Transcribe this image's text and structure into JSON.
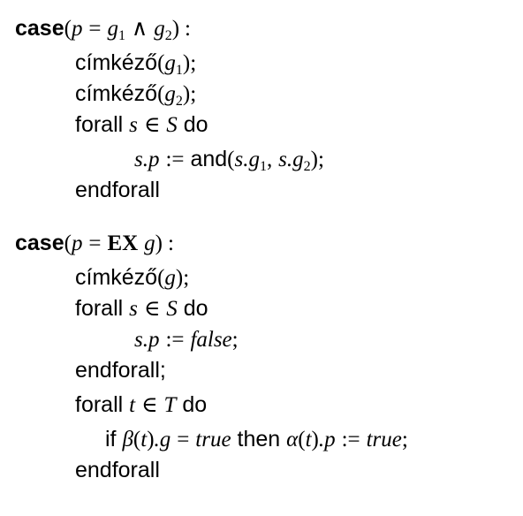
{
  "kw": {
    "case": "case",
    "forall": "forall",
    "do": "do",
    "endforall": "endforall",
    "endforall_semi": "endforall;",
    "if": "if",
    "then": "then",
    "and": "and",
    "label": "címkéző",
    "ex": "EX"
  },
  "sym": {
    "lp": "(",
    "rp": ")",
    "rp_semi": ");",
    "eq": "=",
    "wedge": "∧",
    "in": "∈",
    "assign": ":=",
    "colon": ":",
    "comma": ",",
    "semi": ";",
    "one": "1",
    "two": "2"
  },
  "vars": {
    "p": "p",
    "g": "g",
    "s": "s",
    "S": "S",
    "t": "t",
    "T": "T",
    "beta": "β",
    "alpha": "α",
    "false": "false",
    "true": "true",
    "s_dot_p": "s.p",
    "s_dot_g": "s.g",
    "dot_g": ".g",
    "dot_p": ".p"
  }
}
